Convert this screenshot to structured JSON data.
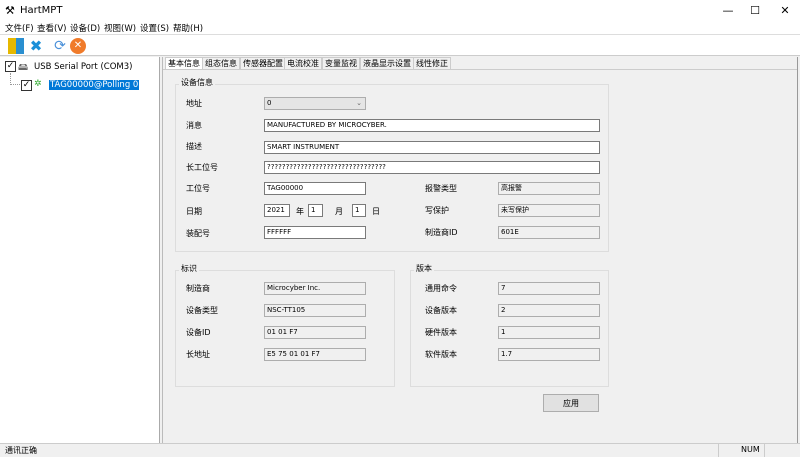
{
  "window": {
    "title": "HartMPT",
    "minimize": "—",
    "maximize": "☐",
    "close": "✕"
  },
  "menu": [
    "文件(F)",
    "查看(V)",
    "设备(D)",
    "视图(W)",
    "设置(S)",
    "帮助(H)"
  ],
  "tree": {
    "port": "USB Serial Port (COM3)",
    "device": "TAG00000@Polling 0"
  },
  "tabs": [
    "基本信息",
    "组态信息",
    "传感器配置",
    "电流校准",
    "变量监视",
    "液晶显示设置",
    "线性修正"
  ],
  "device_info": {
    "title": "设备信息",
    "address_label": "地址",
    "address": "0",
    "message_label": "消息",
    "message": "MANUFACTURED BY MICROCYBER.",
    "descriptor_label": "描述",
    "descriptor": "SMART INSTRUMENT",
    "long_tag_label": "长工位号",
    "long_tag": "????????????????????????????????",
    "tag_label": "工位号",
    "tag": "TAG00000",
    "date_label": "日期",
    "year": "2021",
    "year_unit": "年",
    "month": "1",
    "month_unit": "月",
    "day": "1",
    "day_unit": "日",
    "assembly_label": "装配号",
    "assembly": "FFFFFF",
    "alarm_label": "报警类型",
    "alarm": "高报警",
    "write_protect_label": "写保护",
    "write_protect": "未写保护",
    "manufacturer_id_label": "制造商ID",
    "manufacturer_id": "601E"
  },
  "identity": {
    "title": "标识",
    "manufacturer_label": "制造商",
    "manufacturer": "Microcyber Inc.",
    "device_type_label": "设备类型",
    "device_type": "NSC-TT105",
    "device_id_label": "设备ID",
    "device_id": "01 01 F7",
    "long_address_label": "长地址",
    "long_address": "E5 75 01 01 F7"
  },
  "version": {
    "title": "版本",
    "universal_label": "通用命令",
    "universal": "7",
    "device_rev_label": "设备版本",
    "device_rev": "2",
    "hardware_label": "硬件版本",
    "hardware": "1",
    "software_label": "软件版本",
    "software": "1.7"
  },
  "apply_label": "应用",
  "status": {
    "message": "通讯正确",
    "num": "NUM"
  }
}
